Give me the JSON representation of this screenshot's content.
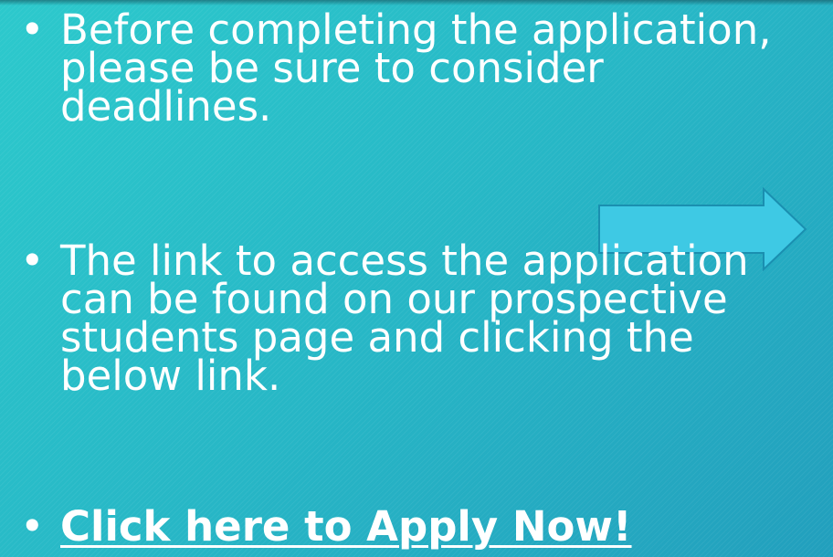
{
  "bullets": [
    {
      "marker": "•",
      "text": "Before completing the application, please be sure to consider deadlines."
    },
    {
      "marker": "•",
      "text": "The link to access the application can be found on our prospective students page and clicking the below link."
    },
    {
      "marker": "•",
      "text": "Click here to Apply Now!"
    }
  ],
  "colors": {
    "background_start": "#2cc9cc",
    "background_end": "#229fbd",
    "arrow_fill": "#3ec9e4",
    "arrow_stroke": "#1a8fb0",
    "text": "#ffffff"
  },
  "icons": {
    "arrow": "right-arrow-icon"
  }
}
